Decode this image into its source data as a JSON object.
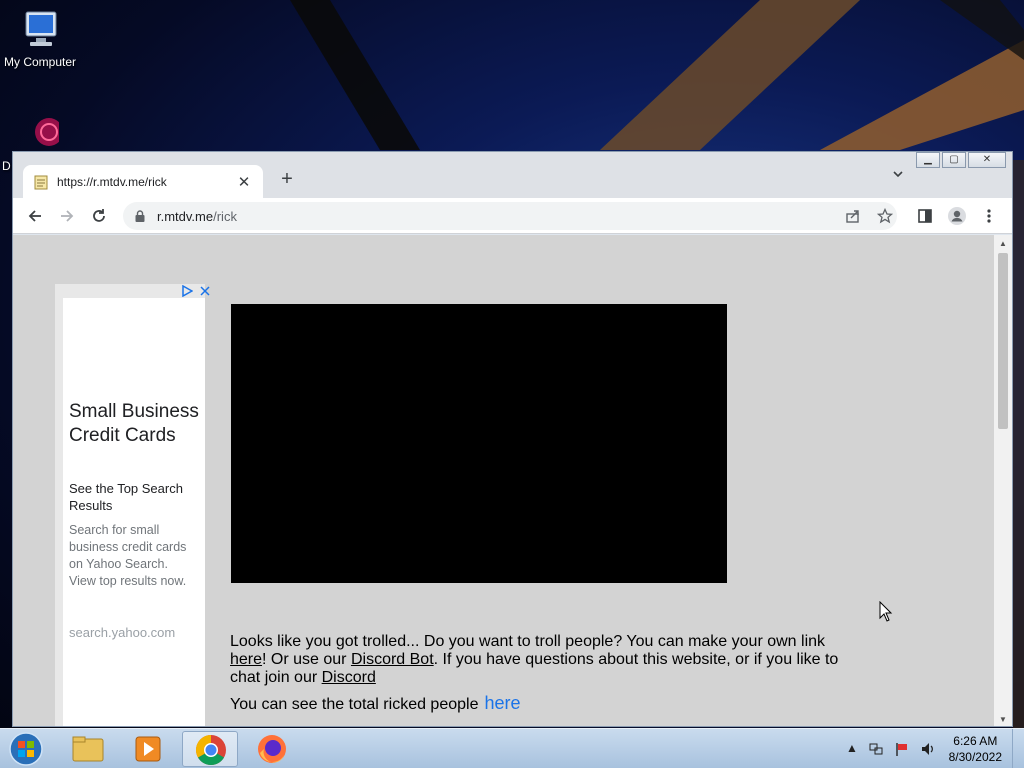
{
  "desktop": {
    "icons": [
      {
        "label": "My Computer"
      },
      {
        "label": "D"
      }
    ]
  },
  "browser": {
    "tab": {
      "title": "https://r.mtdv.me/rick",
      "close": "✕"
    },
    "new_tab": "+",
    "address": {
      "host": "r.mtdv.me",
      "path": "/rick"
    }
  },
  "page": {
    "ad": {
      "headline": "Small Business Credit Cards",
      "subhead": "See the Top Search Results",
      "body": "Search for small business credit cards on Yahoo Search. View top results now.",
      "display_url": "search.yahoo.com"
    },
    "message": {
      "part1": "Looks like you got trolled... Do you want to troll people? You can make your own link ",
      "link1": "here",
      "part2": "! Or use our ",
      "link2": "Discord Bot",
      "part3": ". If you have questions about this website, or if you like to chat join our ",
      "link3": "Discord"
    },
    "counter": {
      "text": "You can see the total ricked people",
      "link": "here"
    }
  },
  "taskbar": {
    "clock_time": "6:26 AM",
    "clock_date": "8/30/2022"
  },
  "colors": {
    "link_blue": "#1a73e8",
    "page_bg": "#d3d3d3",
    "tab_strip": "#dee1e6"
  }
}
